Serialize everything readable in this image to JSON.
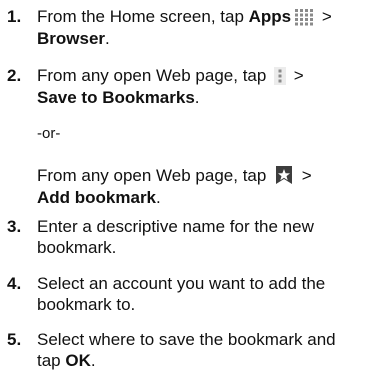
{
  "steps": [
    {
      "number": "1.",
      "line1_pre": "From the Home screen, tap ",
      "line1_bold": "Apps",
      "line1_post": " >",
      "line2_bold": "Browser",
      "line2_post": "."
    },
    {
      "number": "2.",
      "line1_pre": "From any open Web page, tap ",
      "line1_post": " >",
      "line2_bold": "Save to Bookmarks",
      "line2_post": "."
    },
    {
      "or_text": "-or-",
      "line1_pre": "From any open Web page, tap ",
      "line1_post": " >",
      "line2_bold": "Add bookmark",
      "line2_post": "."
    },
    {
      "number": "3.",
      "line1": "Enter a descriptive name for the new",
      "line2": "bookmark."
    },
    {
      "number": "4.",
      "line1": "Select an account you want to add the",
      "line2": "bookmark to."
    },
    {
      "number": "5.",
      "line1": "Select where to save the bookmark and",
      "line2_pre": "tap ",
      "line2_bold": "OK",
      "line2_post": "."
    }
  ],
  "icons": {
    "apps": "apps-grid-icon",
    "menu": "overflow-menu-icon",
    "bookmark": "bookmark-star-icon"
  },
  "colors": {
    "text": "#111111",
    "icon_gray": "#8a8a8a",
    "icon_dark": "#3d3d3d"
  }
}
